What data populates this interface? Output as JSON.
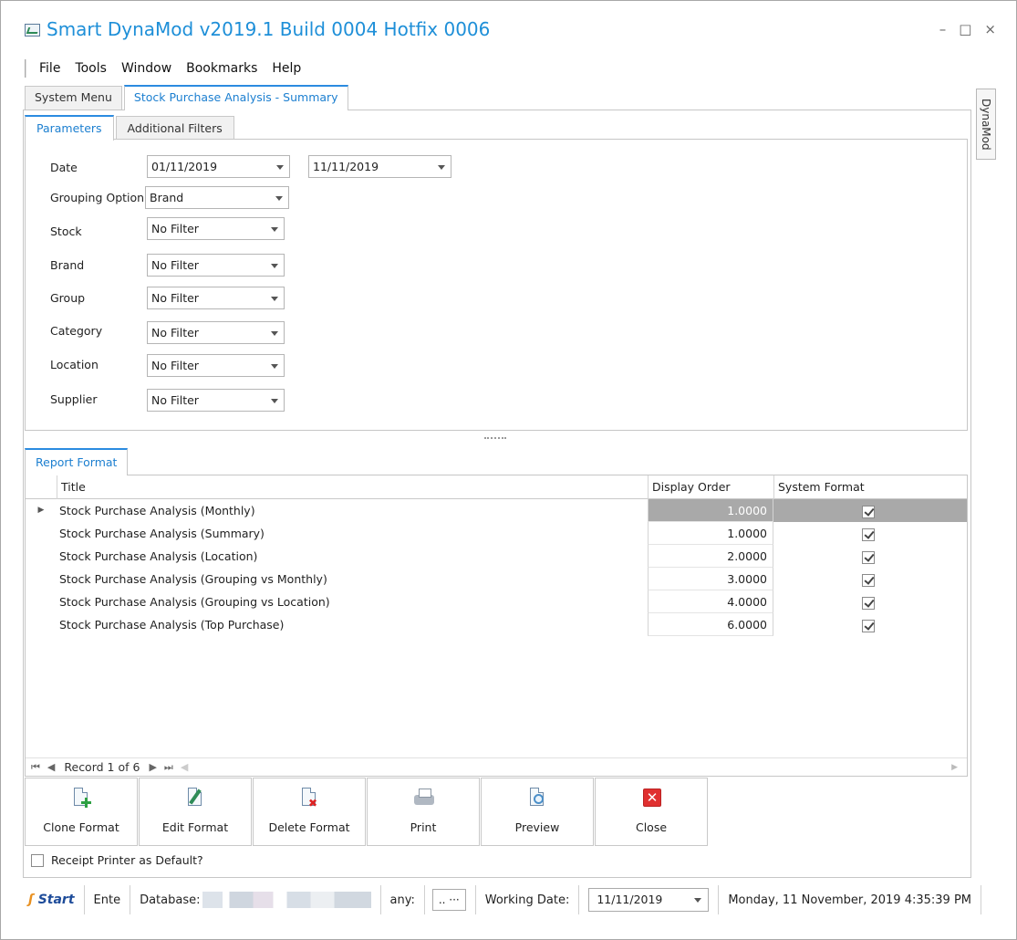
{
  "window": {
    "title": "Smart DynaMod v2019.1 Build 0004 Hotfix 0006",
    "controls": {
      "minimize": "–",
      "maximize": "□",
      "close": "×"
    }
  },
  "menu": [
    "File",
    "Tools",
    "Window",
    "Bookmarks",
    "Help"
  ],
  "main_tabs": [
    "System Menu",
    "Stock Purchase Analysis - Summary"
  ],
  "side_tab": "DynaMod",
  "sub_tabs": [
    "Parameters",
    "Additional Filters"
  ],
  "params": {
    "date": {
      "label": "Date",
      "from": "01/11/2019",
      "to": "11/11/2019"
    },
    "grouping": {
      "label": "Grouping Option",
      "value": "Brand"
    },
    "stock": {
      "label": "Stock",
      "value": "No Filter"
    },
    "brand": {
      "label": "Brand",
      "value": "No Filter"
    },
    "group": {
      "label": "Group",
      "value": "No Filter"
    },
    "category": {
      "label": "Category",
      "value": "No Filter"
    },
    "location": {
      "label": "Location",
      "value": "No Filter"
    },
    "supplier": {
      "label": "Supplier",
      "value": "No Filter"
    }
  },
  "report_format": {
    "tab": "Report Format",
    "columns": {
      "title": "Title",
      "order": "Display Order",
      "system": "System Format"
    },
    "rows": [
      {
        "title": "Stock Purchase Analysis (Monthly)",
        "order": "1.0000",
        "system": true,
        "selected": true
      },
      {
        "title": "Stock Purchase Analysis (Summary)",
        "order": "1.0000",
        "system": true
      },
      {
        "title": "Stock Purchase Analysis (Location)",
        "order": "2.0000",
        "system": true
      },
      {
        "title": "Stock Purchase Analysis (Grouping vs Monthly)",
        "order": "3.0000",
        "system": true
      },
      {
        "title": "Stock Purchase Analysis (Grouping vs Location)",
        "order": "4.0000",
        "system": true
      },
      {
        "title": "Stock Purchase Analysis (Top Purchase)",
        "order": "6.0000",
        "system": true
      }
    ],
    "navigator": {
      "record_text": "Record 1 of 6"
    }
  },
  "buttons": {
    "clone": "Clone Format",
    "edit": "Edit Format",
    "delete": "Delete Format",
    "print": "Print",
    "preview": "Preview",
    "close": "Close"
  },
  "receipt_printer_label": "Receipt Printer as Default?",
  "status": {
    "logo_text": "Start",
    "ente": "Ente",
    "database_label": "Database:",
    "any_label": "any:",
    "ellipsis": ".. ···",
    "working_date_label": "Working Date:",
    "working_date": "11/11/2019",
    "datetime": "Monday, 11 November, 2019 4:35:39 PM"
  },
  "colors": {
    "accent": "#1e8fd8",
    "selected_row": "#a9a9a9"
  }
}
